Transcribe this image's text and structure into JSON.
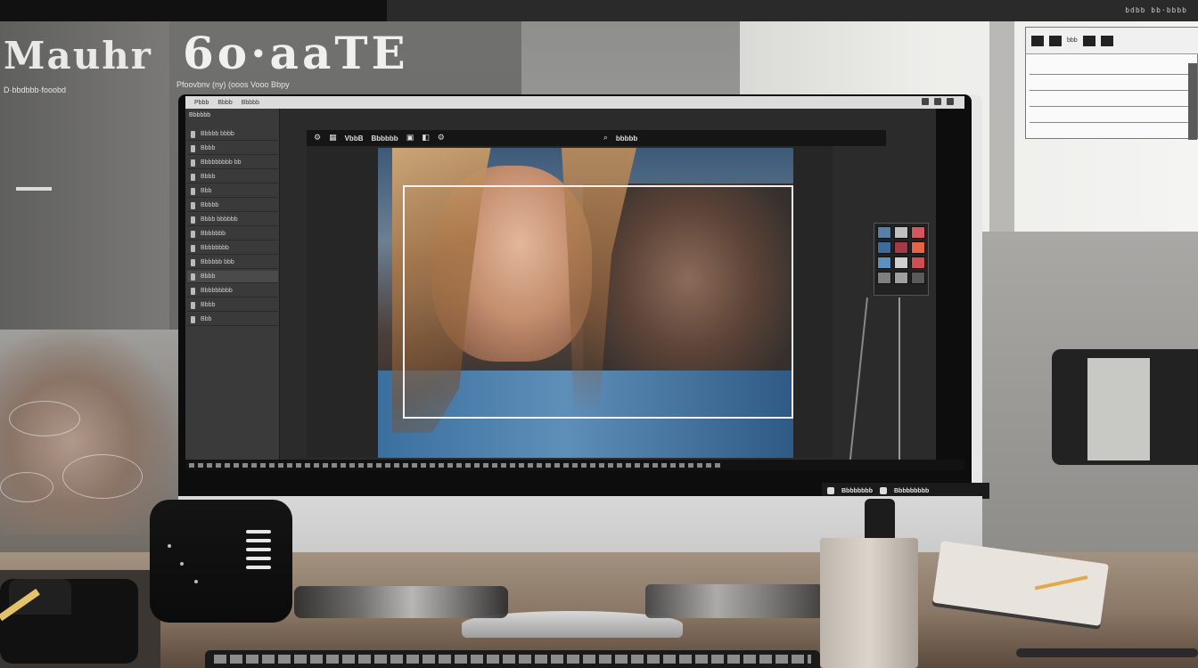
{
  "overlay": {
    "headline_left": "Mauhr",
    "headline_main": "6o·aaTE",
    "subtitle_left": "D·bbdbbb·fooobd",
    "subtitle_main": "Pfoovbnv (ny) (ooos Vooo Bbpy"
  },
  "top_strip": {
    "label": "bdbb bb·bbbb"
  },
  "app": {
    "menu": [
      "Pbbb",
      "Bbbb",
      "Bbbbb"
    ],
    "panel_header": "Bbbbbb",
    "layers": [
      "Bbbbb bbbb",
      "Bbbb",
      "Bbbbbbbbb bb",
      "Bbbb",
      "Bbb",
      "Bbbbb",
      "Bbbb bbbbbb",
      "Bbbbbbb",
      "Bbbbbbbb",
      "Bbbbbb bbb",
      "Bbbb",
      "Bbbbbbbbb",
      "Bbbb",
      "Bbb"
    ],
    "toolbar": {
      "label_a": "VbbB",
      "label_b": "Bbbbbb",
      "label_c": "bbbbb"
    },
    "float_label": {
      "left": "Bbbbbbbb",
      "right": "Bbbbbbbbb"
    }
  },
  "swatches": [
    "#5a7ea6",
    "#c0c0c0",
    "#d0575e",
    "#3e6b9a",
    "#a33a4a",
    "#e46545",
    "#5d8fc0",
    "#cfcfcf",
    "#cf4f4f",
    "#7f7f7f",
    "#a0a0a0",
    "#5a5a5a"
  ],
  "float_panel": {
    "label": "bbb"
  },
  "colors": {
    "screen_bg": "#2b2b2b",
    "crop_frame": "#f2f2f2",
    "desk": "#8b7866"
  }
}
